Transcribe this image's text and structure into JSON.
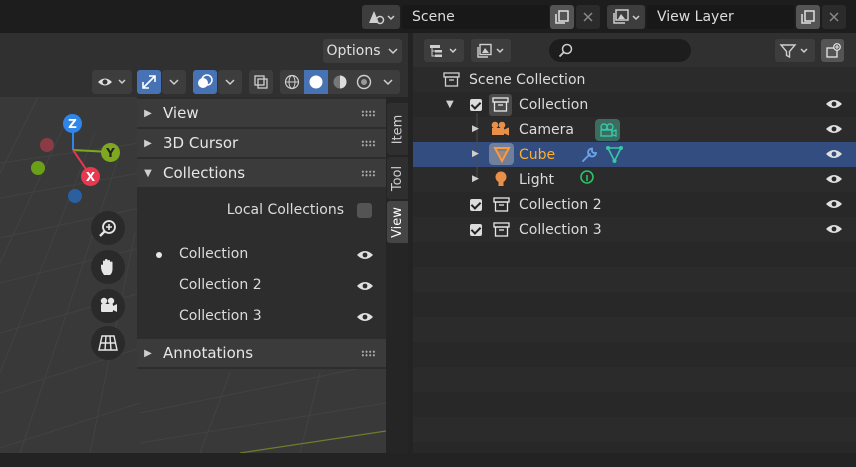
{
  "topbar": {
    "scene_name": "Scene",
    "view_layer_name": "View Layer"
  },
  "viewport": {
    "options_label": "Options",
    "gizmo_axes": {
      "x": "X",
      "y": "Y",
      "z": "Z"
    },
    "tabs": [
      "Item",
      "Tool",
      "View"
    ],
    "active_tab": "View",
    "sidebar": {
      "sections": {
        "view": "View",
        "cursor": "3D Cursor",
        "collections": "Collections",
        "annotations": "Annotations"
      },
      "local_collections_label": "Local Collections",
      "local_collections_checked": false,
      "collection_items": [
        "Collection",
        "Collection 2",
        "Collection 3"
      ],
      "active_collection": "Collection"
    }
  },
  "outliner": {
    "search_placeholder": "",
    "rows": [
      {
        "label": "Scene Collection"
      },
      {
        "label": "Collection"
      },
      {
        "label": "Camera"
      },
      {
        "label": "Cube"
      },
      {
        "label": "Light"
      },
      {
        "label": "Collection 2"
      },
      {
        "label": "Collection 3"
      }
    ],
    "selected": "Cube",
    "colors": {
      "selection": "#334d80",
      "active_text": "#ffaf29",
      "object_orange": "#e8904a",
      "data_green": "#35c9a6",
      "modifier_blue": "#6ca4e8",
      "light_green": "#29c465"
    }
  },
  "gizmo_colors": {
    "x": "#e8374f",
    "y": "#7ea81f",
    "z": "#2f86e8"
  }
}
